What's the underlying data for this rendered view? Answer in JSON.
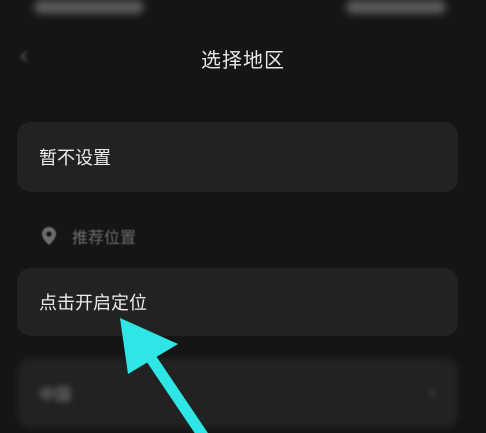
{
  "header": {
    "title": "选择地区",
    "back_icon": "chevron-left-icon"
  },
  "options": {
    "no_set_label": "暂不设置",
    "recommended_section_label": "推荐位置",
    "locate_label": "点击开启定位",
    "country_label": "中国"
  },
  "annotation": {
    "arrow_color": "#2fe6e6",
    "icon": "arrow-up-left-icon"
  },
  "colors": {
    "background": "#151515",
    "card": "#222222",
    "text": "#ececec",
    "muted": "#6c6c6c"
  }
}
